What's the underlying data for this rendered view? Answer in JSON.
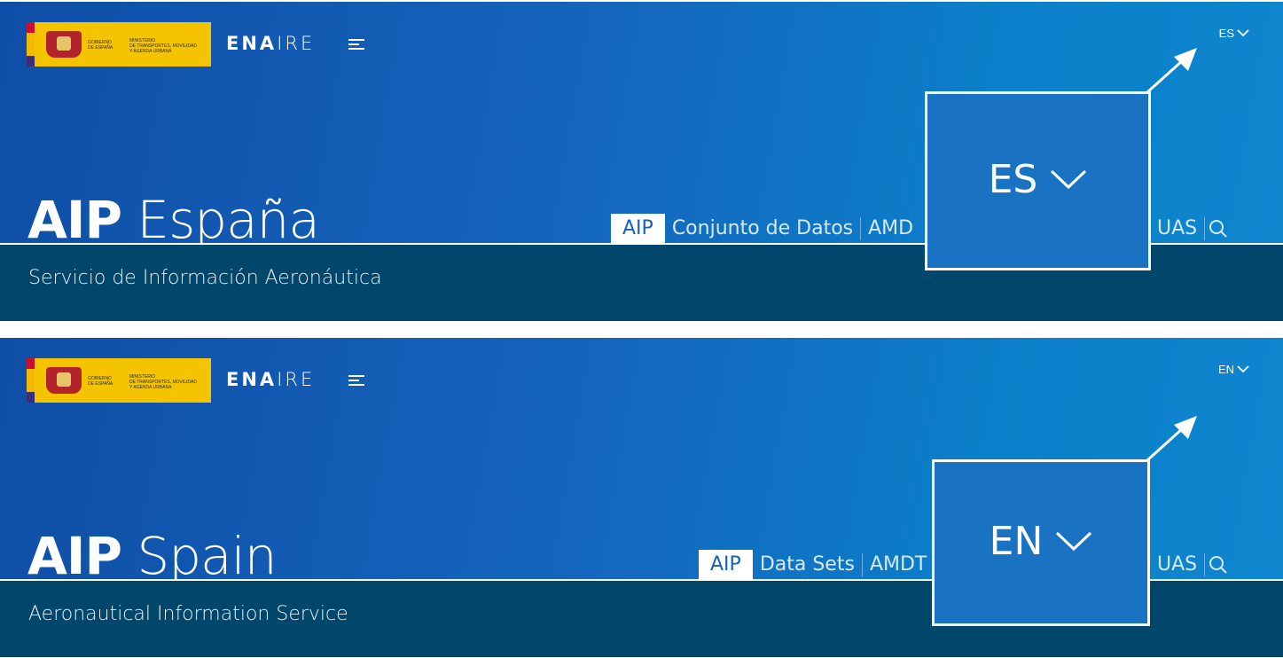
{
  "panels": {
    "es": {
      "logo": {
        "gobierno": "GOBIERNO\nDE ESPAÑA",
        "ministerio": "MINISTERIO\nDE TRANSPORTES, MOVILIDAD\nY AGENDA URBANA"
      },
      "brand": {
        "bold": "ENA",
        "light": "IRE"
      },
      "language_selector": "ES",
      "title": {
        "bold": "AIP",
        "light": "España"
      },
      "subtitle": "Servicio de Información Aeronáutica",
      "nav": [
        "AIP",
        "Conjunto de Datos",
        "AMD"
      ],
      "nav_right": [
        "UAS"
      ],
      "callout_label": "ES"
    },
    "en": {
      "logo": {
        "gobierno": "GOBIERNO\nDE ESPAÑA",
        "ministerio": "MINISTERIO\nDE TRANSPORTES, MOVILIDAD\nY AGENDA URBANA"
      },
      "brand": {
        "bold": "ENA",
        "light": "IRE"
      },
      "language_selector": "EN",
      "title": {
        "bold": "AIP",
        "light": "Spain"
      },
      "subtitle": "Aeronautical Information Service",
      "nav": [
        "AIP",
        "Data Sets",
        "AMDT"
      ],
      "nav_right": [
        "UAS"
      ],
      "callout_label": "EN"
    }
  },
  "icons": {
    "search": "search-icon",
    "chevron": "chevron-down-icon",
    "arrow": "arrow-up-right-icon"
  },
  "colors": {
    "header_blue": "#1565bd",
    "subbar": "#01466b",
    "logo_yellow": "#f5c400",
    "active_tab_text": "#1662b9"
  }
}
